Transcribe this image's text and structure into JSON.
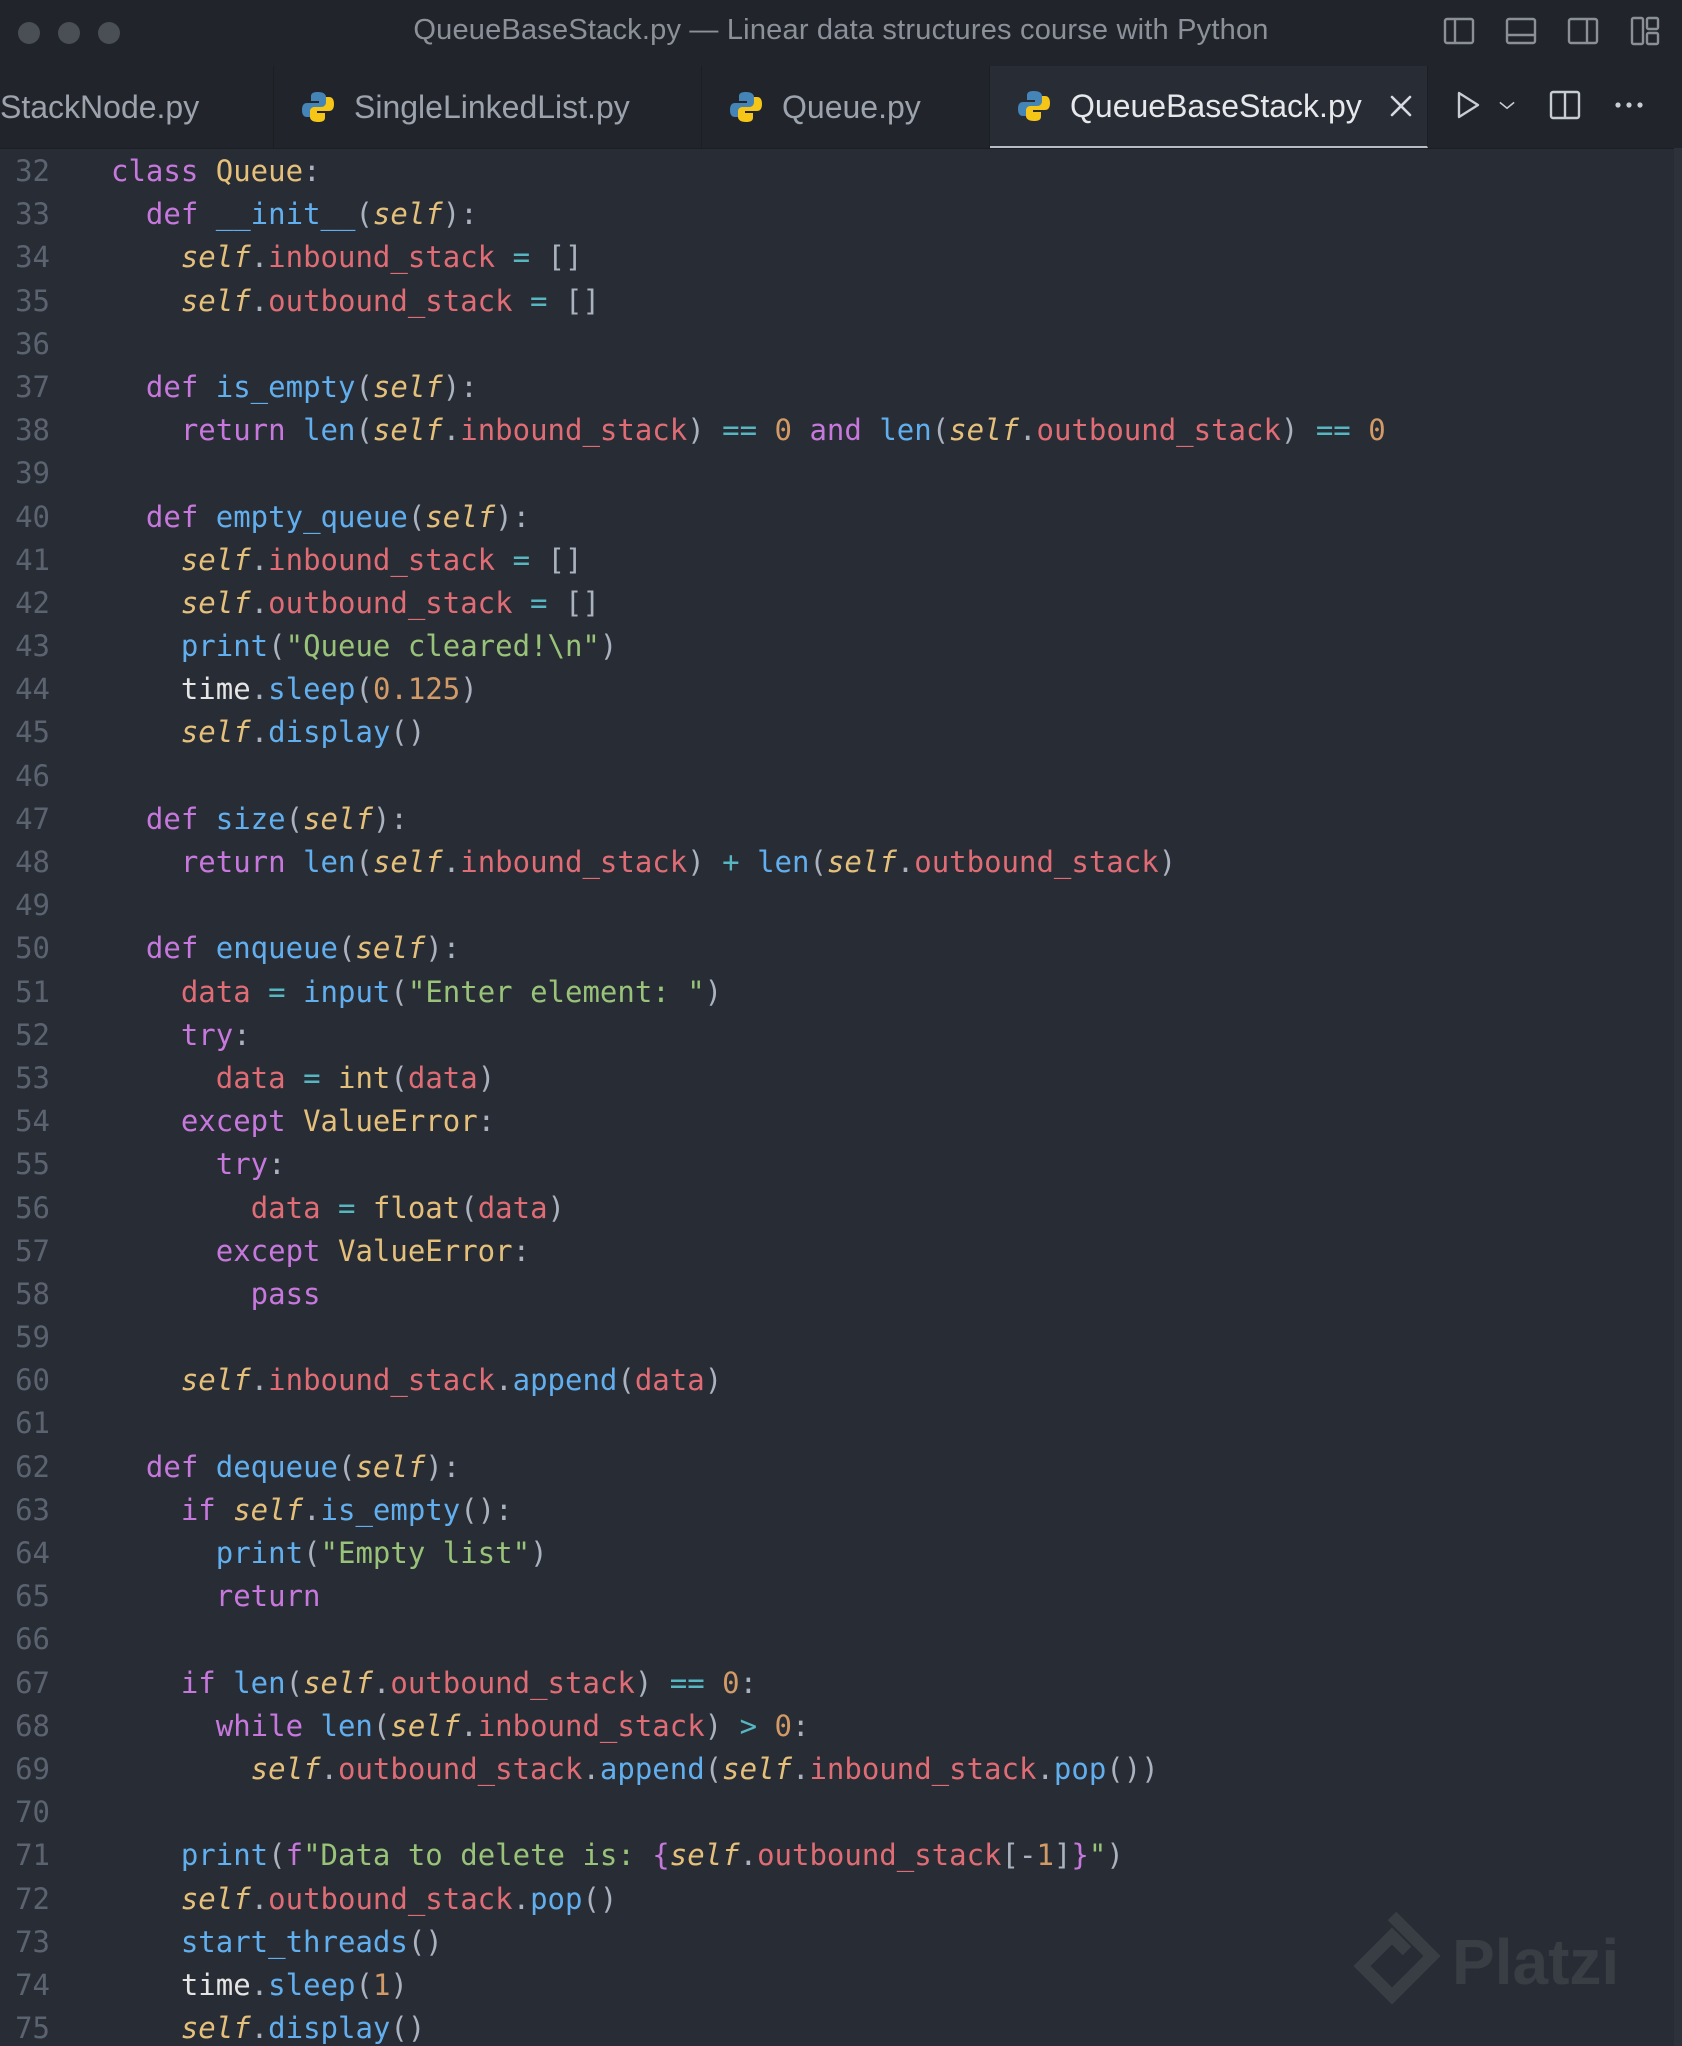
{
  "window": {
    "title": "QueueBaseStack.py — Linear data structures course with Python"
  },
  "tabs": [
    {
      "label": "StackNode.py",
      "active": false
    },
    {
      "label": "SingleLinkedList.py",
      "active": false
    },
    {
      "label": "Queue.py",
      "active": false
    },
    {
      "label": "QueueBaseStack.py",
      "active": true
    }
  ],
  "icons": {
    "file": "python-file-icon",
    "close": "close-icon",
    "run": "run-icon",
    "run_menu": "chevron-down-icon",
    "split": "split-editor-icon",
    "more": "more-icon"
  },
  "watermark": "Platzi",
  "colors": {
    "background": "#282c34",
    "keyword": "#c678dd",
    "function": "#61afef",
    "self": "#e5c07b",
    "attribute": "#e06c75",
    "string": "#98c379",
    "number": "#d19a66"
  },
  "code": [
    {
      "n": "32",
      "t": [
        [
          "kw",
          "class "
        ],
        [
          "cls",
          "Queue"
        ],
        [
          "pun",
          ":"
        ]
      ]
    },
    {
      "n": "33",
      "t": [
        [
          "kw",
          "  def "
        ],
        [
          "fn",
          "__init__"
        ],
        [
          "pun",
          "("
        ],
        [
          "slf",
          "self"
        ],
        [
          "pun",
          "):"
        ]
      ]
    },
    {
      "n": "34",
      "t": [
        [
          "pun",
          "    "
        ],
        [
          "slf",
          "self"
        ],
        [
          "pun",
          "."
        ],
        [
          "attr",
          "inbound_stack"
        ],
        [
          "op",
          " = "
        ],
        [
          "pun",
          "[]"
        ]
      ]
    },
    {
      "n": "35",
      "t": [
        [
          "pun",
          "    "
        ],
        [
          "slf",
          "self"
        ],
        [
          "pun",
          "."
        ],
        [
          "attr",
          "outbound_stack"
        ],
        [
          "op",
          " = "
        ],
        [
          "pun",
          "[]"
        ]
      ]
    },
    {
      "n": "36",
      "t": []
    },
    {
      "n": "37",
      "t": [
        [
          "kw",
          "  def "
        ],
        [
          "fn",
          "is_empty"
        ],
        [
          "pun",
          "("
        ],
        [
          "slf",
          "self"
        ],
        [
          "pun",
          "):"
        ]
      ]
    },
    {
      "n": "38",
      "t": [
        [
          "kw",
          "    return "
        ],
        [
          "fn",
          "len"
        ],
        [
          "pun",
          "("
        ],
        [
          "slf",
          "self"
        ],
        [
          "pun",
          "."
        ],
        [
          "attr",
          "inbound_stack"
        ],
        [
          "pun",
          ")"
        ],
        [
          "op",
          " == "
        ],
        [
          "num",
          "0"
        ],
        [
          "kw",
          " and "
        ],
        [
          "fn",
          "len"
        ],
        [
          "pun",
          "("
        ],
        [
          "slf",
          "self"
        ],
        [
          "pun",
          "."
        ],
        [
          "attr",
          "outbound_stack"
        ],
        [
          "pun",
          ")"
        ],
        [
          "op",
          " == "
        ],
        [
          "num",
          "0"
        ]
      ]
    },
    {
      "n": "39",
      "t": []
    },
    {
      "n": "40",
      "t": [
        [
          "kw",
          "  def "
        ],
        [
          "fn",
          "empty_queue"
        ],
        [
          "pun",
          "("
        ],
        [
          "slf",
          "self"
        ],
        [
          "pun",
          "):"
        ]
      ]
    },
    {
      "n": "41",
      "t": [
        [
          "pun",
          "    "
        ],
        [
          "slf",
          "self"
        ],
        [
          "pun",
          "."
        ],
        [
          "attr",
          "inbound_stack"
        ],
        [
          "op",
          " = "
        ],
        [
          "pun",
          "[]"
        ]
      ]
    },
    {
      "n": "42",
      "t": [
        [
          "pun",
          "    "
        ],
        [
          "slf",
          "self"
        ],
        [
          "pun",
          "."
        ],
        [
          "attr",
          "outbound_stack"
        ],
        [
          "op",
          " = "
        ],
        [
          "pun",
          "[]"
        ]
      ]
    },
    {
      "n": "43",
      "t": [
        [
          "pun",
          "    "
        ],
        [
          "fn",
          "print"
        ],
        [
          "pun",
          "("
        ],
        [
          "str",
          "\"Queue cleared!\\n\""
        ],
        [
          "pun",
          ")"
        ]
      ]
    },
    {
      "n": "44",
      "t": [
        [
          "pun",
          "    "
        ],
        [
          "plain",
          "time"
        ],
        [
          "pun",
          "."
        ],
        [
          "fn",
          "sleep"
        ],
        [
          "pun",
          "("
        ],
        [
          "num",
          "0.125"
        ],
        [
          "pun",
          ")"
        ]
      ]
    },
    {
      "n": "45",
      "t": [
        [
          "pun",
          "    "
        ],
        [
          "slf",
          "self"
        ],
        [
          "pun",
          "."
        ],
        [
          "fn",
          "display"
        ],
        [
          "pun",
          "()"
        ]
      ]
    },
    {
      "n": "46",
      "t": []
    },
    {
      "n": "47",
      "t": [
        [
          "kw",
          "  def "
        ],
        [
          "fn",
          "size"
        ],
        [
          "pun",
          "("
        ],
        [
          "slf",
          "self"
        ],
        [
          "pun",
          "):"
        ]
      ]
    },
    {
      "n": "48",
      "t": [
        [
          "kw",
          "    return "
        ],
        [
          "fn",
          "len"
        ],
        [
          "pun",
          "("
        ],
        [
          "slf",
          "self"
        ],
        [
          "pun",
          "."
        ],
        [
          "attr",
          "inbound_stack"
        ],
        [
          "pun",
          ")"
        ],
        [
          "op",
          " + "
        ],
        [
          "fn",
          "len"
        ],
        [
          "pun",
          "("
        ],
        [
          "slf",
          "self"
        ],
        [
          "pun",
          "."
        ],
        [
          "attr",
          "outbound_stack"
        ],
        [
          "pun",
          ")"
        ]
      ]
    },
    {
      "n": "49",
      "t": []
    },
    {
      "n": "50",
      "t": [
        [
          "kw",
          "  def "
        ],
        [
          "fn",
          "enqueue"
        ],
        [
          "pun",
          "("
        ],
        [
          "slf",
          "self"
        ],
        [
          "pun",
          "):"
        ]
      ]
    },
    {
      "n": "51",
      "t": [
        [
          "pun",
          "    "
        ],
        [
          "var",
          "data"
        ],
        [
          "op",
          " = "
        ],
        [
          "fn",
          "input"
        ],
        [
          "pun",
          "("
        ],
        [
          "str",
          "\"Enter element: \""
        ],
        [
          "pun",
          ")"
        ]
      ]
    },
    {
      "n": "52",
      "t": [
        [
          "kw",
          "    try"
        ],
        [
          "pun",
          ":"
        ]
      ]
    },
    {
      "n": "53",
      "t": [
        [
          "pun",
          "      "
        ],
        [
          "var",
          "data"
        ],
        [
          "op",
          " = "
        ],
        [
          "cls",
          "int"
        ],
        [
          "pun",
          "("
        ],
        [
          "var",
          "data"
        ],
        [
          "pun",
          ")"
        ]
      ]
    },
    {
      "n": "54",
      "t": [
        [
          "kw",
          "    except "
        ],
        [
          "cls",
          "ValueError"
        ],
        [
          "pun",
          ":"
        ]
      ]
    },
    {
      "n": "55",
      "t": [
        [
          "kw",
          "      try"
        ],
        [
          "pun",
          ":"
        ]
      ]
    },
    {
      "n": "56",
      "t": [
        [
          "pun",
          "        "
        ],
        [
          "var",
          "data"
        ],
        [
          "op",
          " = "
        ],
        [
          "cls",
          "float"
        ],
        [
          "pun",
          "("
        ],
        [
          "var",
          "data"
        ],
        [
          "pun",
          ")"
        ]
      ]
    },
    {
      "n": "57",
      "t": [
        [
          "kw",
          "      except "
        ],
        [
          "cls",
          "ValueError"
        ],
        [
          "pun",
          ":"
        ]
      ]
    },
    {
      "n": "58",
      "t": [
        [
          "kw",
          "        pass"
        ]
      ]
    },
    {
      "n": "59",
      "t": []
    },
    {
      "n": "60",
      "t": [
        [
          "pun",
          "    "
        ],
        [
          "slf",
          "self"
        ],
        [
          "pun",
          "."
        ],
        [
          "attr",
          "inbound_stack"
        ],
        [
          "pun",
          "."
        ],
        [
          "fn",
          "append"
        ],
        [
          "pun",
          "("
        ],
        [
          "var",
          "data"
        ],
        [
          "pun",
          ")"
        ]
      ]
    },
    {
      "n": "61",
      "t": []
    },
    {
      "n": "62",
      "t": [
        [
          "kw",
          "  def "
        ],
        [
          "fn",
          "dequeue"
        ],
        [
          "pun",
          "("
        ],
        [
          "slf",
          "self"
        ],
        [
          "pun",
          "):"
        ]
      ]
    },
    {
      "n": "63",
      "t": [
        [
          "kw",
          "    if "
        ],
        [
          "slf",
          "self"
        ],
        [
          "pun",
          "."
        ],
        [
          "fn",
          "is_empty"
        ],
        [
          "pun",
          "():"
        ]
      ]
    },
    {
      "n": "64",
      "t": [
        [
          "pun",
          "      "
        ],
        [
          "fn",
          "print"
        ],
        [
          "pun",
          "("
        ],
        [
          "str",
          "\"Empty list\""
        ],
        [
          "pun",
          ")"
        ]
      ]
    },
    {
      "n": "65",
      "t": [
        [
          "kw",
          "      return"
        ]
      ]
    },
    {
      "n": "66",
      "t": []
    },
    {
      "n": "67",
      "t": [
        [
          "kw",
          "    if "
        ],
        [
          "fn",
          "len"
        ],
        [
          "pun",
          "("
        ],
        [
          "slf",
          "self"
        ],
        [
          "pun",
          "."
        ],
        [
          "attr",
          "outbound_stack"
        ],
        [
          "pun",
          ")"
        ],
        [
          "op",
          " == "
        ],
        [
          "num",
          "0"
        ],
        [
          "pun",
          ":"
        ]
      ]
    },
    {
      "n": "68",
      "t": [
        [
          "kw",
          "      while "
        ],
        [
          "fn",
          "len"
        ],
        [
          "pun",
          "("
        ],
        [
          "slf",
          "self"
        ],
        [
          "pun",
          "."
        ],
        [
          "attr",
          "inbound_stack"
        ],
        [
          "pun",
          ")"
        ],
        [
          "op",
          " > "
        ],
        [
          "num",
          "0"
        ],
        [
          "pun",
          ":"
        ]
      ]
    },
    {
      "n": "69",
      "t": [
        [
          "pun",
          "        "
        ],
        [
          "slf",
          "self"
        ],
        [
          "pun",
          "."
        ],
        [
          "attr",
          "outbound_stack"
        ],
        [
          "pun",
          "."
        ],
        [
          "fn",
          "append"
        ],
        [
          "pun",
          "("
        ],
        [
          "slf",
          "self"
        ],
        [
          "pun",
          "."
        ],
        [
          "attr",
          "inbound_stack"
        ],
        [
          "pun",
          "."
        ],
        [
          "fn",
          "pop"
        ],
        [
          "pun",
          "())"
        ]
      ]
    },
    {
      "n": "70",
      "t": []
    },
    {
      "n": "71",
      "t": [
        [
          "pun",
          "    "
        ],
        [
          "fn",
          "print"
        ],
        [
          "pun",
          "("
        ],
        [
          "kw",
          "f"
        ],
        [
          "str",
          "\"Data to delete is: "
        ],
        [
          "kw",
          "{"
        ],
        [
          "slf",
          "self"
        ],
        [
          "pun",
          "."
        ],
        [
          "attr",
          "outbound_stack"
        ],
        [
          "pun",
          "[-"
        ],
        [
          "num",
          "1"
        ],
        [
          "pun",
          "]"
        ],
        [
          "kw",
          "}"
        ],
        [
          "str",
          "\""
        ],
        [
          "pun",
          ")"
        ]
      ]
    },
    {
      "n": "72",
      "t": [
        [
          "pun",
          "    "
        ],
        [
          "slf",
          "self"
        ],
        [
          "pun",
          "."
        ],
        [
          "attr",
          "outbound_stack"
        ],
        [
          "pun",
          "."
        ],
        [
          "fn",
          "pop"
        ],
        [
          "pun",
          "()"
        ]
      ]
    },
    {
      "n": "73",
      "t": [
        [
          "pun",
          "    "
        ],
        [
          "fn",
          "start_threads"
        ],
        [
          "pun",
          "()"
        ]
      ]
    },
    {
      "n": "74",
      "t": [
        [
          "pun",
          "    "
        ],
        [
          "plain",
          "time"
        ],
        [
          "pun",
          "."
        ],
        [
          "fn",
          "sleep"
        ],
        [
          "pun",
          "("
        ],
        [
          "num",
          "1"
        ],
        [
          "pun",
          ")"
        ]
      ]
    },
    {
      "n": "75",
      "t": [
        [
          "pun",
          "    "
        ],
        [
          "slf",
          "self"
        ],
        [
          "pun",
          "."
        ],
        [
          "fn",
          "display"
        ],
        [
          "pun",
          "()"
        ]
      ]
    }
  ]
}
